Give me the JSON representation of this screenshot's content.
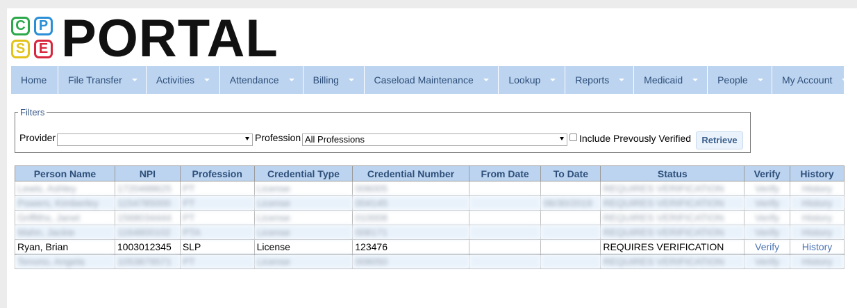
{
  "logo": {
    "letters": [
      "C",
      "P",
      "S",
      "E"
    ],
    "colors": [
      "#2aa84a",
      "#2a8fd6",
      "#e3c21a",
      "#d7263d"
    ],
    "title": "PORTAL"
  },
  "nav": {
    "items": [
      {
        "label": "Home",
        "dropdown": false
      },
      {
        "label": "File Transfer",
        "dropdown": true
      },
      {
        "label": "Activities",
        "dropdown": true
      },
      {
        "label": "Attendance",
        "dropdown": true
      },
      {
        "label": "Billing",
        "dropdown": true
      },
      {
        "label": "Caseload Maintenance",
        "dropdown": true
      },
      {
        "label": "Lookup",
        "dropdown": true
      },
      {
        "label": "Reports",
        "dropdown": true
      },
      {
        "label": "Medicaid",
        "dropdown": true
      },
      {
        "label": "People",
        "dropdown": true
      },
      {
        "label": "My Account",
        "dropdown": true
      }
    ]
  },
  "filters": {
    "legend": "Filters",
    "provider_label": "Provider",
    "provider_value": "",
    "profession_label": "Profession",
    "profession_value": "All Professions",
    "include_label": "Include Prevously Verified",
    "include_checked": false,
    "retrieve_label": "Retrieve"
  },
  "table": {
    "headers": [
      "Person Name",
      "NPI",
      "Profession",
      "Credential Type",
      "Credential Number",
      "From Date",
      "To Date",
      "Status",
      "Verify",
      "History"
    ],
    "rows": [
      {
        "blurred": true,
        "cells": [
          "Lewis, Ashley",
          "1720488625",
          "PT",
          "License",
          "006005",
          "",
          "",
          "REQUIRES VERIFICATION",
          "Verify",
          "History"
        ]
      },
      {
        "blurred": true,
        "cells": [
          "Powers, Kimberley",
          "1154785000",
          "PT",
          "License",
          "004145",
          "",
          "06/30/2019",
          "REQUIRES VERIFICATION",
          "Verify",
          "History"
        ]
      },
      {
        "blurred": true,
        "cells": [
          "Griffiths, Janet",
          "1568034444",
          "PT",
          "License",
          "010008",
          "",
          "",
          "REQUIRES VERIFICATION",
          "Verify",
          "History"
        ]
      },
      {
        "blurred": true,
        "cells": [
          "Mahn, Jackie",
          "1164800102",
          "PTA",
          "License",
          "006171",
          "",
          "",
          "REQUIRES VERIFICATION",
          "Verify",
          "History"
        ]
      },
      {
        "blurred": false,
        "cells": [
          "Ryan, Brian",
          "1003012345",
          "SLP",
          "License",
          "123476",
          "",
          "",
          "REQUIRES VERIFICATION",
          "Verify",
          "History"
        ]
      },
      {
        "blurred": true,
        "cells": [
          "Tenorio, Angela",
          "1053879571",
          "PT",
          "License",
          "008050",
          "",
          "",
          "REQUIRES VERIFICATION",
          "Verify",
          "History"
        ]
      }
    ]
  }
}
